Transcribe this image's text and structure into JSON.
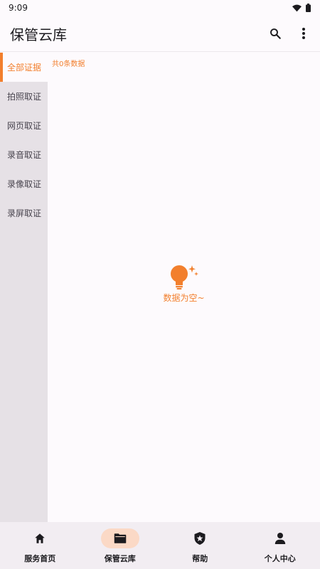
{
  "status_bar": {
    "time": "9:09"
  },
  "app_bar": {
    "title": "保管云库"
  },
  "evidence": {
    "categories": [
      {
        "label": "全部证据",
        "active": true
      },
      {
        "label": "拍照取证",
        "active": false
      },
      {
        "label": "网页取证",
        "active": false
      },
      {
        "label": "录音取证",
        "active": false
      },
      {
        "label": "录像取证",
        "active": false
      },
      {
        "label": "录屏取证",
        "active": false
      }
    ],
    "count_text": "共0条数据",
    "empty_text": "数据为空~"
  },
  "bottom_nav": {
    "items": [
      {
        "label": "服务首页",
        "icon": "home-icon",
        "active": false
      },
      {
        "label": "保管云库",
        "icon": "folder-icon",
        "active": true
      },
      {
        "label": "帮助",
        "icon": "shield-star-icon",
        "active": false
      },
      {
        "label": "个人中心",
        "icon": "person-icon",
        "active": false
      }
    ]
  },
  "colors": {
    "accent": "#f27f2d",
    "sidebar_bg": "#e6e1e6",
    "nav_pill": "#fbd9c6"
  }
}
